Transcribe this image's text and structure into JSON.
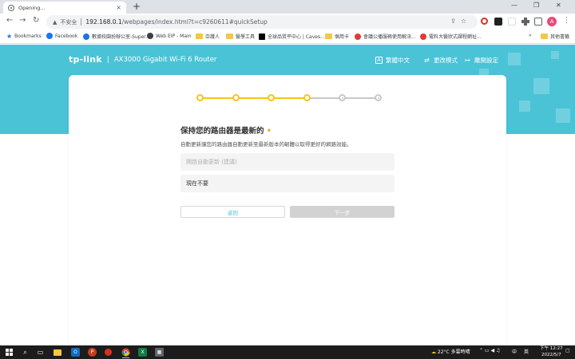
{
  "browser": {
    "tab_title": "Opening...",
    "tab_close": "×",
    "new_tab": "+",
    "window_controls": [
      "—",
      "❐",
      "✕"
    ],
    "address": {
      "security_label": "不安全",
      "url_host": "192.168.0.1",
      "url_path": "/webpages/index.html?t=c9260611#quickSetup"
    },
    "nav": {
      "back": "←",
      "forward": "→",
      "reload": "↻"
    },
    "profile_initial": "A",
    "menu": "⋮"
  },
  "bookmarks": {
    "items": [
      {
        "label": "Bookmarks",
        "type": "star"
      },
      {
        "label": "Facebook",
        "type": "site",
        "color": "#1877f2"
      },
      {
        "label": "數據校園扮辦公室-Super...",
        "type": "site",
        "color": "#1a73e8"
      },
      {
        "label": "Web EIP - Main",
        "type": "site",
        "color": "#3c4043"
      },
      {
        "label": "亞護人",
        "type": "folder"
      },
      {
        "label": "醫學工具",
        "type": "folder"
      },
      {
        "label": "全球品質平中心 | Caves...",
        "type": "site",
        "color": "#000000"
      },
      {
        "label": "個用卡",
        "type": "folder"
      },
      {
        "label": "會議公播服務使用解決...",
        "type": "site",
        "color": "#e53935"
      },
      {
        "label": "電料大醫狀式課程網址...",
        "type": "site",
        "color": "#e53935"
      }
    ],
    "overflow": "»",
    "other_folder": "其他書籤"
  },
  "router": {
    "logo": "tp-link",
    "product": "AX3000 Gigabit Wi-Fi 6 Router",
    "header_links": [
      {
        "label": "繁體中文",
        "icon": "language-icon",
        "glyph": "A"
      },
      {
        "label": "更改模式",
        "icon": "switch-mode-icon",
        "glyph": "⇄"
      },
      {
        "label": "離開設定",
        "icon": "exit-icon",
        "glyph": "↦"
      }
    ],
    "steps": {
      "total": 6,
      "completed": 4
    },
    "heading": "保持您的路由器是最新的",
    "heading_mark": "•",
    "description": "自動更新讓您的路由器自動更新至最新版本的韌體以取得更好的網路效能。",
    "options": [
      {
        "label": "開啟自動更新 (建議)",
        "placeholder": true
      },
      {
        "label": "現在不要",
        "placeholder": false
      }
    ],
    "back_label": "返回",
    "next_label": "下一步",
    "colors": {
      "banner": "#4ac3d6",
      "step_done": "#f5c518",
      "step_todo": "#c8c8c8",
      "next_disabled": "#d2d2d2"
    }
  },
  "taskbar": {
    "weather": "22°C  多雲時晴",
    "ime": "中",
    "ime2": "英",
    "time": "下午 12:27",
    "date": "2022/5/7"
  }
}
